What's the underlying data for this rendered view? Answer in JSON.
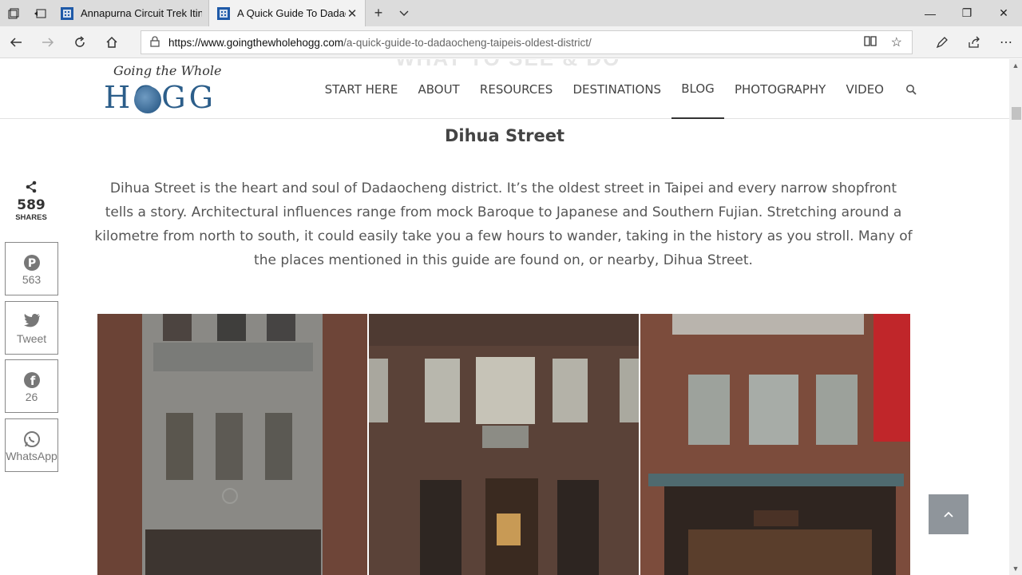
{
  "browser": {
    "tabs": [
      {
        "title": "Annapurna Circuit Trek Itine",
        "active": false
      },
      {
        "title": "A Quick Guide To Dadao",
        "active": true
      }
    ],
    "url_host": "https://www.goingthewholehogg.com",
    "url_path": "/a-quick-guide-to-dadaocheng-taipeis-oldest-district/"
  },
  "site": {
    "logo_script": "Going the Whole",
    "logo_main": "HOGG",
    "nav": [
      "START HERE",
      "ABOUT",
      "RESOURCES",
      "DESTINATIONS",
      "BLOG",
      "PHOTOGRAPHY",
      "VIDEO"
    ],
    "ghost_heading": "WHAT TO SEE & DO"
  },
  "article": {
    "heading": "Dihua Street",
    "paragraph": "Dihua Street is the heart and soul of Dadaocheng district. It’s the oldest street in Taipei and every narrow shopfront tells a story. Architectural influences range from mock Baroque to Japanese and Southern Fujian. Stretching around a kilometre from north to south, it could easily take you a few hours to wander, taking in the history as you stroll. Many of the places mentioned in this guide are found on, or nearby, Dihua Street."
  },
  "share": {
    "count": "589",
    "label": "SHARES",
    "pinterest": "563",
    "twitter": "Tweet",
    "facebook": "26",
    "whatsapp": "WhatsApp"
  },
  "icons": {
    "accent": "#2c5e8a",
    "totop": "#8f959b"
  }
}
